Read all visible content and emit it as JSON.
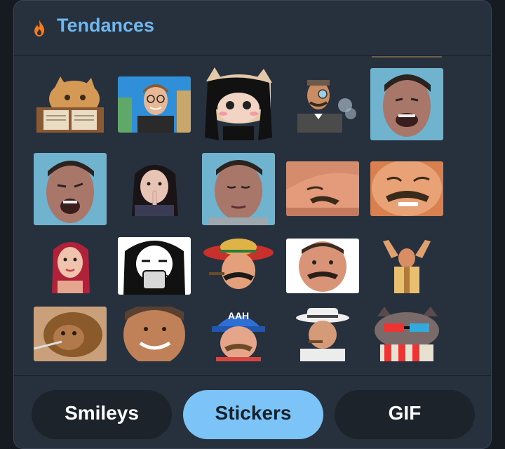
{
  "header": {
    "title": "Tendances",
    "icon": "flame-icon",
    "title_color": "#6fb7ee",
    "icon_color": "#f57c1f"
  },
  "stickers": [
    {
      "name": "cat-reading-book-sticker"
    },
    {
      "name": "man-with-glasses-sticker"
    },
    {
      "name": "cat-black-hair-sticker"
    },
    {
      "name": "monocle-gentleman-sticker"
    },
    {
      "name": "man-laughing-sticker"
    },
    {
      "name": "man-screaming-sticker"
    },
    {
      "name": "girl-finger-lips-sticker"
    },
    {
      "name": "man-eyes-closed-sticker"
    },
    {
      "name": "mustache-man-looking-down-sticker"
    },
    {
      "name": "mustache-man-laughing-sticker"
    },
    {
      "name": "red-hair-woman-sticker"
    },
    {
      "name": "anime-girl-mug-sticker"
    },
    {
      "name": "sombrero-mustache-man-sticker"
    },
    {
      "name": "mustache-man-smiling-sticker"
    },
    {
      "name": "man-hands-up-sticker"
    },
    {
      "name": "orangutan-sticker"
    },
    {
      "name": "smiling-bald-man-sticker"
    },
    {
      "name": "blue-hat-man-sticker"
    },
    {
      "name": "hat-man-cigar-sticker"
    },
    {
      "name": "cat-3d-glasses-popcorn-sticker"
    }
  ],
  "sticker_text": {
    "blue_hat": "AAH"
  },
  "tabs": [
    {
      "label": "Smileys",
      "active": false
    },
    {
      "label": "Stickers",
      "active": true
    },
    {
      "label": "GIF",
      "active": false
    }
  ],
  "colors": {
    "panel": "#27303d",
    "tab": "#1d232b",
    "tab_active": "#7cc4f7"
  }
}
